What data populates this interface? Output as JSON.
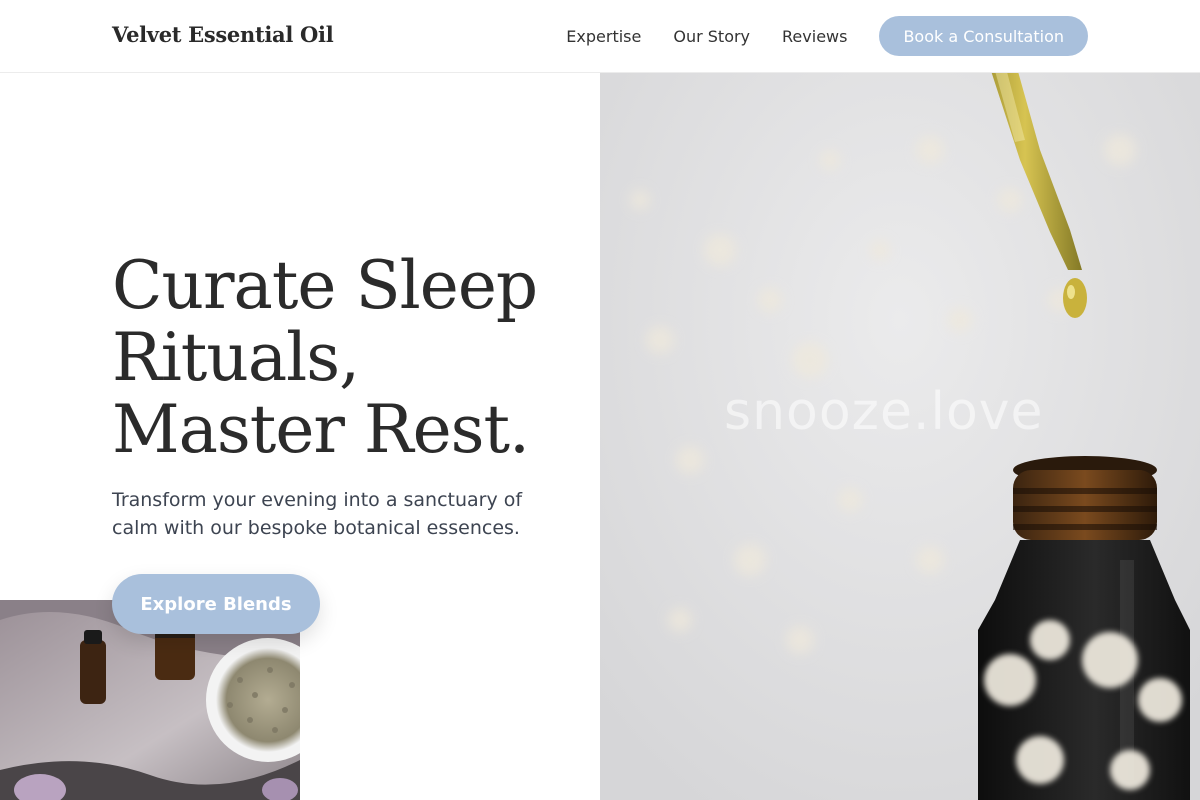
{
  "header": {
    "brand": "Velvet Essential Oil",
    "nav": [
      {
        "label": "Expertise"
      },
      {
        "label": "Our Story"
      },
      {
        "label": "Reviews"
      }
    ],
    "cta_label": "Book a Consultation"
  },
  "hero": {
    "headline": "Curate Sleep Rituals, Master Rest.",
    "subtext": "Transform your evening into a sanctuary of calm with our bespoke botanical essences.",
    "button_label": "Explore Blends",
    "watermark": "snooze.love"
  },
  "colors": {
    "accent": "#a9c0dc",
    "text": "#2b2b2b",
    "subtext": "#3d4451"
  },
  "images": {
    "hero": "dropper-and-amber-bottle-photo",
    "inset": "lavender-and-oil-bottles-photo"
  }
}
